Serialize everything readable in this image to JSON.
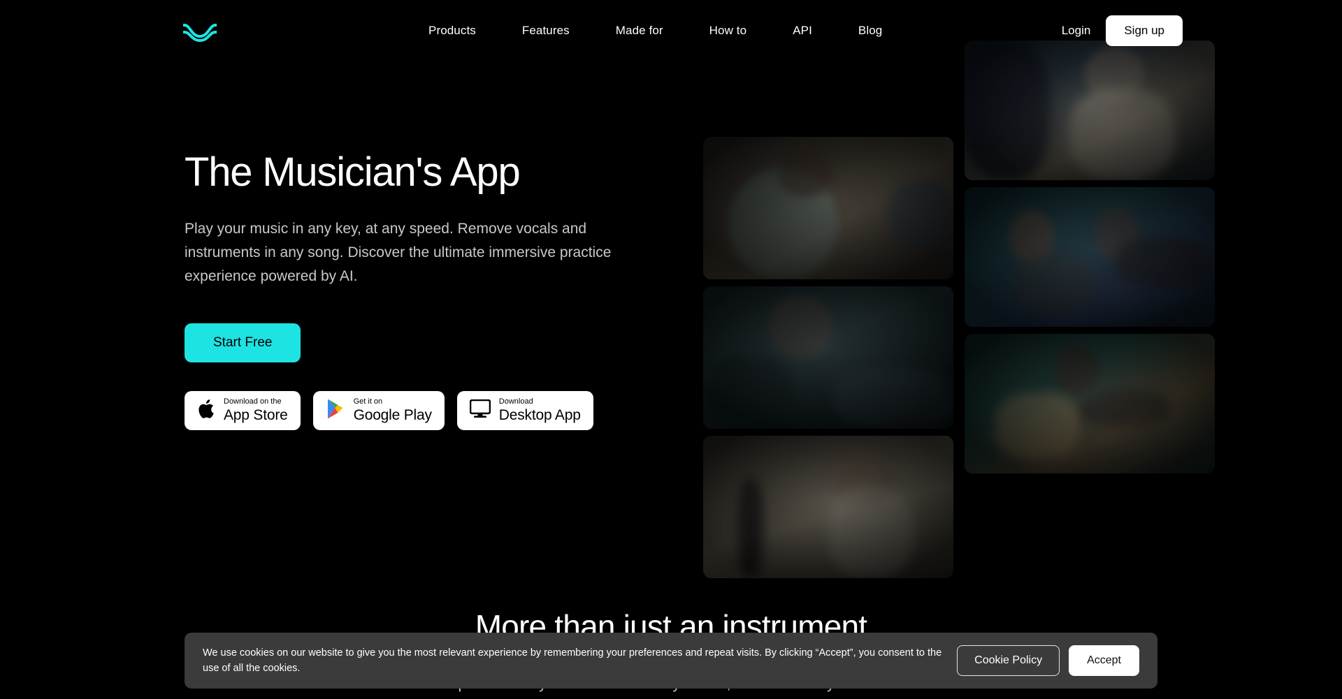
{
  "brand": {
    "logo_icon": "wave-logo-icon",
    "accent_color": "#1ee3e3",
    "background_color": "#000000"
  },
  "nav": {
    "links": [
      {
        "label": "Products"
      },
      {
        "label": "Features"
      },
      {
        "label": "Made for"
      },
      {
        "label": "How to"
      },
      {
        "label": "API"
      },
      {
        "label": "Blog"
      }
    ],
    "login_label": "Login",
    "signup_label": "Sign up"
  },
  "hero": {
    "title": "The Musician's App",
    "subtitle": "Play your music in any key, at any speed. Remove vocals and instruments in any song. Discover the ultimate immersive practice experience powered by AI.",
    "cta_label": "Start Free",
    "badges": [
      {
        "icon": "apple-icon",
        "small": "Download on the",
        "big": "App Store"
      },
      {
        "icon": "google-play-icon",
        "small": "Get it on",
        "big": "Google Play"
      },
      {
        "icon": "desktop-monitor-icon",
        "small": "Download",
        "big": "Desktop App"
      }
    ],
    "gallery": [
      {
        "name": "bassist-home-studio",
        "alt": "Bassist with headphones playing bass in a home studio"
      },
      {
        "name": "drummer-at-kit",
        "alt": "Drummer seated behind a drum kit"
      },
      {
        "name": "guitarist-at-microphone",
        "alt": "Older guitarist singing at a microphone"
      },
      {
        "name": "vocalist-at-microphone",
        "alt": "Vocalist singing into a microphone"
      },
      {
        "name": "duo-with-tablet-guitar",
        "alt": "Two musicians with a tablet and guitar on a couch"
      },
      {
        "name": "acoustic-guitarist-couch",
        "alt": "Woman playing an acoustic guitar on a couch"
      }
    ]
  },
  "section_two": {
    "title": "More than just an instrument",
    "subtitle": "Your private library accessible from any device, stored securely in the cloud."
  },
  "cookie_banner": {
    "text": "We use cookies on our website to give you the most relevant experience by remembering your preferences and repeat visits. By clicking “Accept”, you consent to the use of all the cookies.",
    "policy_label": "Cookie Policy",
    "accept_label": "Accept"
  }
}
